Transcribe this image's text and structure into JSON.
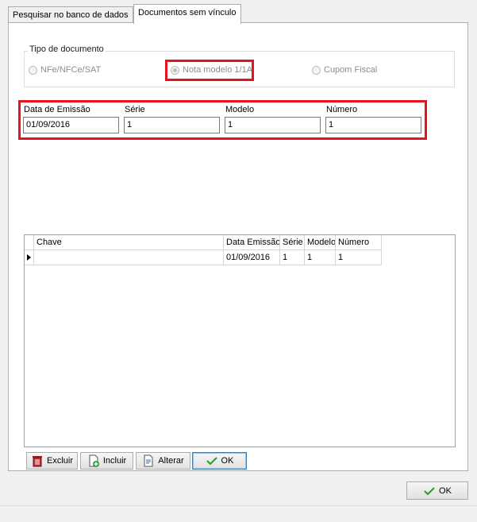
{
  "tabs": [
    {
      "label": "Pesquisar no banco de dados",
      "active": false
    },
    {
      "label": "Documentos sem vínculo",
      "active": true
    }
  ],
  "tipo_documento": {
    "legend": "Tipo de documento",
    "options": [
      {
        "label": "NFe/NFCe/SAT",
        "checked": false
      },
      {
        "label": "Nota modelo 1/1A",
        "checked": true
      },
      {
        "label": "Cupom Fiscal",
        "checked": false
      }
    ]
  },
  "fields": {
    "data_emissao": {
      "label": "Data de Emissão",
      "value": "01/09/2016"
    },
    "serie": {
      "label": "Série",
      "value": "1"
    },
    "modelo": {
      "label": "Modelo",
      "value": "1"
    },
    "numero": {
      "label": "Número",
      "value": "1"
    }
  },
  "grid": {
    "columns": [
      "Chave",
      "Data Emissão",
      "Série",
      "Modelo",
      "Número"
    ],
    "rows": [
      {
        "chave": "",
        "data_emissao": "01/09/2016",
        "serie": "1",
        "modelo": "1",
        "numero": "1"
      }
    ]
  },
  "buttons": {
    "excluir": "Excluir",
    "incluir": "Incluir",
    "alterar": "Alterar",
    "ok_inner": "OK",
    "ok_dialog": "OK"
  },
  "colors": {
    "highlight": "#e3151f",
    "check": "#2a9a2a"
  }
}
